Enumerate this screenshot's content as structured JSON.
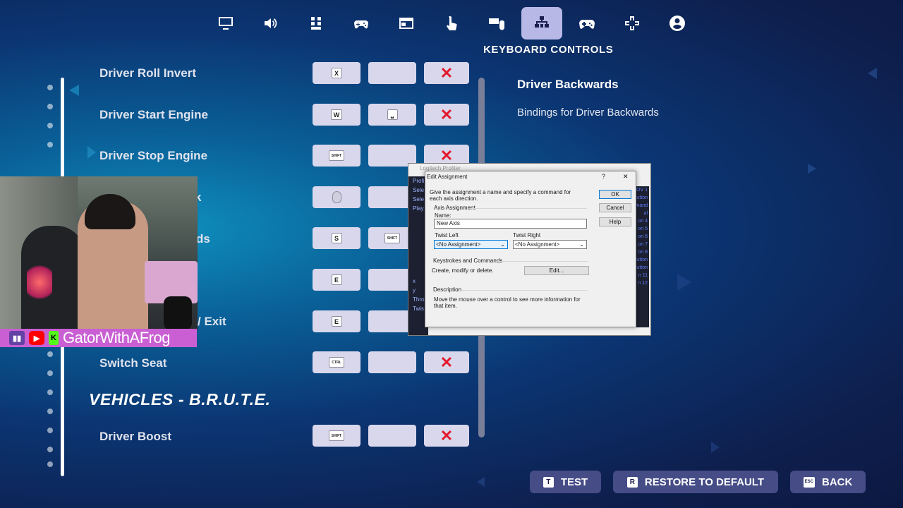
{
  "top_nav": {
    "icons": [
      "monitor-icon",
      "speaker-icon",
      "grid-icon",
      "controller-gear-icon",
      "window-icon",
      "touch-icon",
      "keyboard-mouse-icon",
      "network-icon",
      "gamepad-icon",
      "dpad-icon",
      "account-icon"
    ],
    "active_index": 7,
    "title": "KEYBOARD CONTROLS"
  },
  "controls": {
    "rows": [
      {
        "label": "Driver Roll Invert",
        "key1": "X",
        "key2": "",
        "has_delete": true
      },
      {
        "label": "Driver Start Engine",
        "key1": "W",
        "key2": "⎵",
        "has_delete": true
      },
      {
        "label": "Driver Stop Engine",
        "key1": "SHIFT",
        "key2": "",
        "has_delete": true
      },
      {
        "label": "k",
        "key1": "mouse",
        "key2": "",
        "has_delete": false
      },
      {
        "label": "ds",
        "key1": "S",
        "key2": "SHIFT",
        "has_delete": false
      },
      {
        "label": "",
        "key1": "E",
        "key2": "",
        "has_delete": false
      },
      {
        "label": "/ Exit",
        "key1": "E",
        "key2": "",
        "has_delete": false
      },
      {
        "label": "Switch Seat",
        "key1": "CTRL",
        "key2": "",
        "has_delete": true
      }
    ],
    "section_heading": "VEHICLES - B.R.U.T.E.",
    "after_section": {
      "label": "Driver Boost",
      "key1": "SHIFT",
      "key2": "",
      "has_delete": true
    },
    "delete_glyph": "✕"
  },
  "binding_panel": {
    "title": "Driver Backwards",
    "description": "Bindings for Driver Backwards"
  },
  "bottom_buttons": [
    {
      "hotkey": "T",
      "label": "TEST"
    },
    {
      "hotkey": "R",
      "label": "RESTORE TO DEFAULT"
    },
    {
      "hotkey": "ESC",
      "label": "BACK"
    }
  ],
  "stream_overlay": {
    "streamer_name": "GatorWithAFrog",
    "platforms": [
      "twitch-icon",
      "youtube-icon",
      "kick-icon"
    ]
  },
  "profiler_window": {
    "title": "Logitech Profiler",
    "left_items": [
      "Profil",
      "Sele",
      "Sele",
      "Play",
      "x",
      "y",
      "Thro",
      "Twis"
    ],
    "right_items": [
      "OV 1",
      "utton",
      "mand",
      "al",
      "on 4",
      "on 5",
      "on 6",
      "on 7",
      "on 8",
      "utton",
      "utton",
      "n 11",
      "n 12"
    ]
  },
  "edit_assignment": {
    "title": "Edit Assignment",
    "help_glyph": "?",
    "close_glyph": "✕",
    "instructions": "Give the assignment a name and specify a command for each axis direction.",
    "group_axis": "Axis Assignment",
    "name_label": "Name:",
    "name_value": "New Axis",
    "twist_left_label": "Twist Left",
    "twist_left_value": "<No Assignment>",
    "twist_right_label": "Twist Right",
    "twist_right_value": "<No Assignment>",
    "group_keystrokes": "Keystrokes and Commands",
    "keystrokes_text": "Create, modify or delete.",
    "edit_button": "Edit...",
    "group_description": "Description",
    "description_text": "Move the mouse over a control to see more information for that item.",
    "ok_button": "OK",
    "cancel_button": "Cancel",
    "help_button": "Help"
  }
}
